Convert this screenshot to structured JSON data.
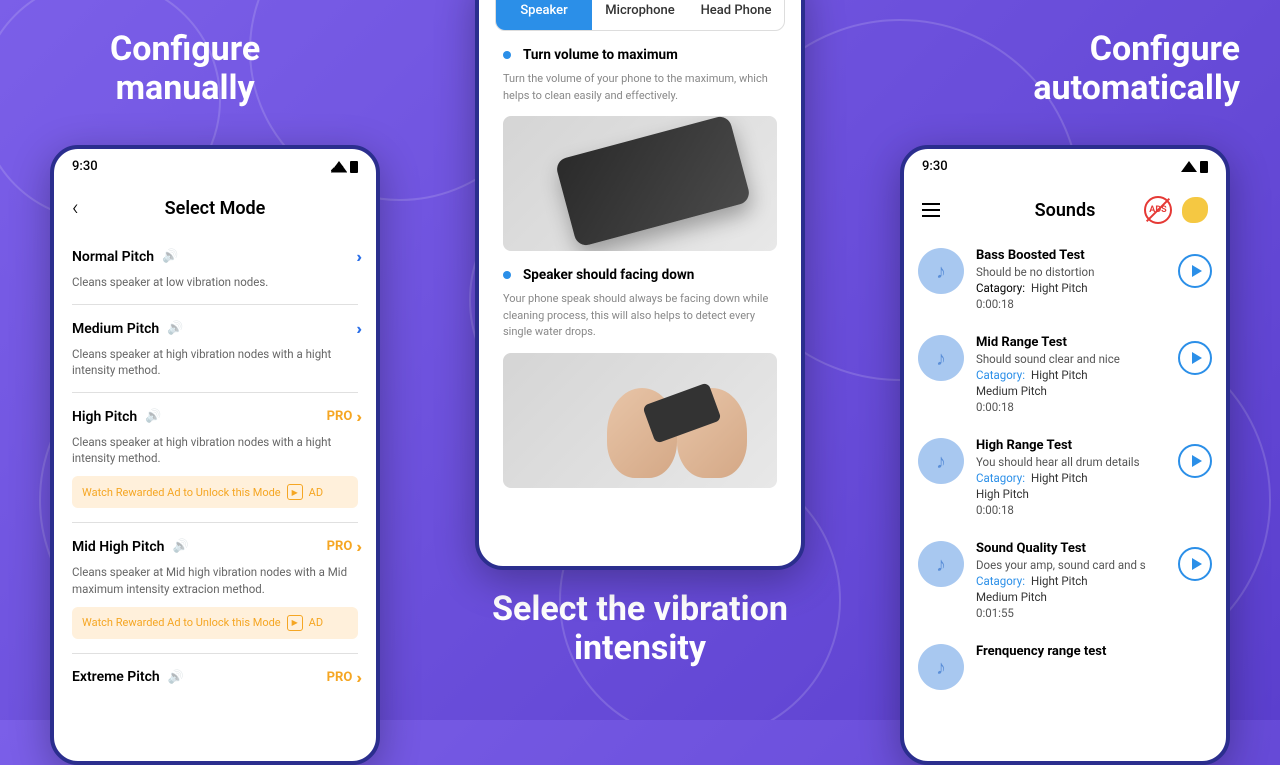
{
  "headings": {
    "left": "Configure\nmanually",
    "center": "Select the vibration\nintensity",
    "right": "Configure\nautomatically"
  },
  "status": {
    "time": "9:30"
  },
  "left": {
    "title": "Select Mode",
    "modes": [
      {
        "name": "Normal Pitch",
        "desc": "Cleans speaker at low vibration nodes.",
        "pro": false
      },
      {
        "name": "Medium Pitch",
        "desc": "Cleans speaker at high vibration nodes with a hight intensity method.",
        "pro": false
      },
      {
        "name": "High Pitch",
        "desc": "Cleans speaker at high vibration nodes with a hight intensity method.",
        "pro": true,
        "ad": true
      },
      {
        "name": "Mid High Pitch",
        "desc": "Cleans speaker at Mid high vibration nodes with a Mid maximum intensity extracion method.",
        "pro": true,
        "ad": true
      },
      {
        "name": "Extreme Pitch",
        "desc": "",
        "pro": true
      }
    ],
    "pro_label": "PRO",
    "ad_text": "Watch Rewarded Ad to Unlock this Mode",
    "ad_badge": "AD"
  },
  "center": {
    "tabs": [
      "Speaker",
      "Microphone",
      "Head Phone"
    ],
    "active_tab": 0,
    "instructions": [
      {
        "title": "Turn volume to maximum",
        "desc": "Turn the volume of your phone to the maximum, which helps to clean easily and effectively."
      },
      {
        "title": "Speaker should facing down",
        "desc": "Your phone speak should always be facing  down while cleaning process, this will also helps to detect every single water drops."
      }
    ]
  },
  "right": {
    "title": "Sounds",
    "ads_label": "ADS",
    "cat_label": "Catagory:",
    "sounds": [
      {
        "title": "Bass Boosted Test",
        "sub": "Should be no distortion",
        "cat": "Hight Pitch",
        "time": "0:00:18"
      },
      {
        "title": "Mid Range Test",
        "sub": "Should sound clear and nice",
        "cat": "Hight Pitch",
        "extra": "Medium Pitch",
        "time": "0:00:18",
        "cat_blue": true
      },
      {
        "title": "High Range Test",
        "sub": "You should hear all drum details",
        "cat": "Hight Pitch",
        "extra": "High Pitch",
        "time": "0:00:18",
        "cat_blue": true
      },
      {
        "title": "Sound Quality Test",
        "sub": "Does your amp, sound card and s",
        "cat": "Hight Pitch",
        "extra": "Medium Pitch",
        "time": "0:01:55",
        "cat_blue": true
      },
      {
        "title": "Frenquency range test",
        "sub": "",
        "cat": "",
        "time": ""
      }
    ]
  }
}
